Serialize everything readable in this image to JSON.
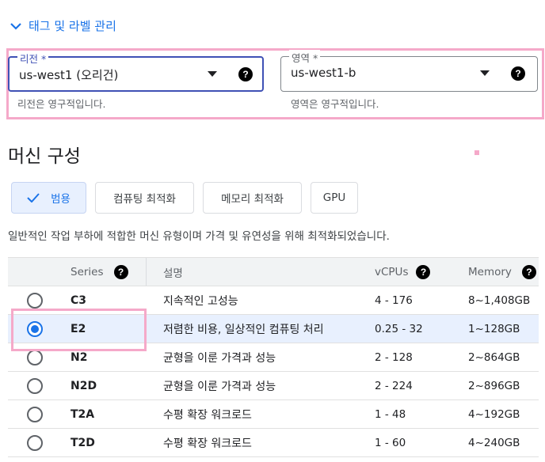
{
  "section_toggle": {
    "label": "태그 및 라벨 관리",
    "icon": "chevron-down-icon"
  },
  "region": {
    "label": "리전 *",
    "value": "us-west1 (오리건)",
    "hint": "리전은 영구적입니다."
  },
  "zone": {
    "label": "영역 *",
    "value": "us-west1-b",
    "hint": "영역은 영구적입니다."
  },
  "heading": "머신 구성",
  "tabs": [
    {
      "label": "범용",
      "selected": true
    },
    {
      "label": "컴퓨팅 최적화",
      "selected": false
    },
    {
      "label": "메모리 최적화",
      "selected": false
    },
    {
      "label": "GPU",
      "selected": false
    }
  ],
  "description": "일반적인 작업 부하에 적합한 머신 유형이며 가격 및 유연성을 위해 최적화되었습니다.",
  "table": {
    "headers": {
      "series": "Series",
      "desc": "설명",
      "vcpus": "vCPUs",
      "memory": "Memory"
    },
    "rows": [
      {
        "series": "C3",
        "desc": "지속적인 고성능",
        "vcpus": "4 - 176",
        "memory": "8~1,408GB",
        "selected": false
      },
      {
        "series": "E2",
        "desc": "저렴한 비용, 일상적인 컴퓨팅 처리",
        "vcpus": "0.25 - 32",
        "memory": "1~128GB",
        "selected": true
      },
      {
        "series": "N2",
        "desc": "균형을 이룬 가격과 성능",
        "vcpus": "2 - 128",
        "memory": "2~864GB",
        "selected": false
      },
      {
        "series": "N2D",
        "desc": "균형을 이룬 가격과 성능",
        "vcpus": "2 - 224",
        "memory": "2~896GB",
        "selected": false
      },
      {
        "series": "T2A",
        "desc": "수평 확장 워크로드",
        "vcpus": "1 - 48",
        "memory": "4~192GB",
        "selected": false
      },
      {
        "series": "T2D",
        "desc": "수평 확장 워크로드",
        "vcpus": "1 - 60",
        "memory": "4~240GB",
        "selected": false
      }
    ]
  },
  "colors": {
    "accent": "#1a73e8",
    "highlight": "#f5a9c9",
    "selected_bg": "#e8f0fe"
  }
}
